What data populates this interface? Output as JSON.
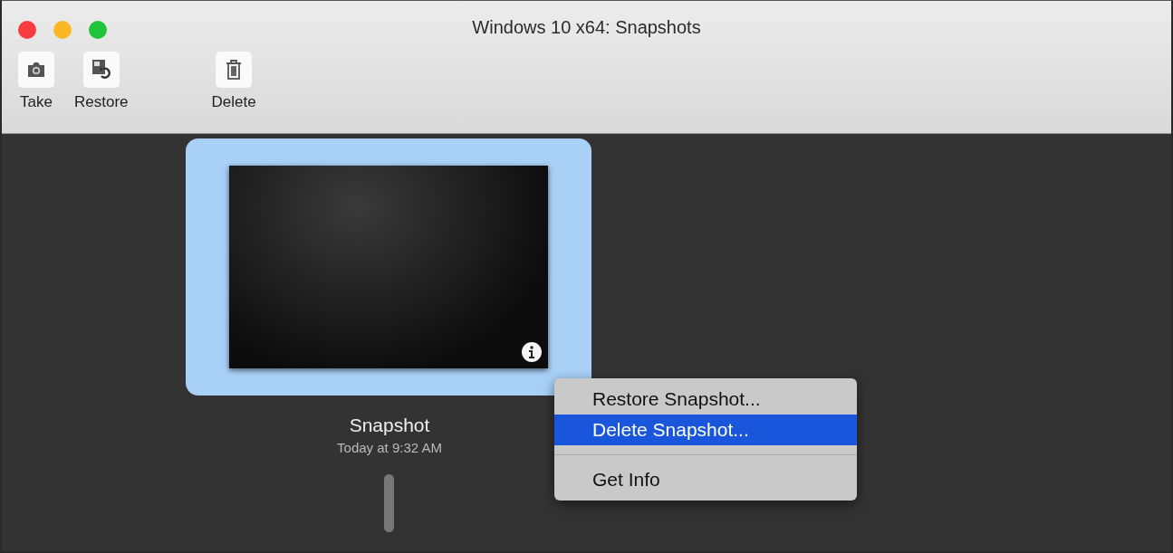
{
  "window": {
    "title": "Windows 10 x64: Snapshots"
  },
  "toolbar": [
    {
      "label": "Take",
      "kind": "camera"
    },
    {
      "label": "Restore",
      "kind": "restore"
    },
    {
      "label": "Delete",
      "kind": "trash"
    }
  ],
  "snapshot": {
    "name": "Snapshot",
    "time": "Today at 9:32 AM",
    "selected": true
  },
  "context_menu": [
    {
      "kind": "item",
      "label": "Restore Snapshot...",
      "selected": false
    },
    {
      "kind": "item",
      "label": "Delete Snapshot...",
      "selected": true
    },
    {
      "kind": "separator"
    },
    {
      "kind": "item",
      "label": "Get Info",
      "selected": false
    }
  ]
}
